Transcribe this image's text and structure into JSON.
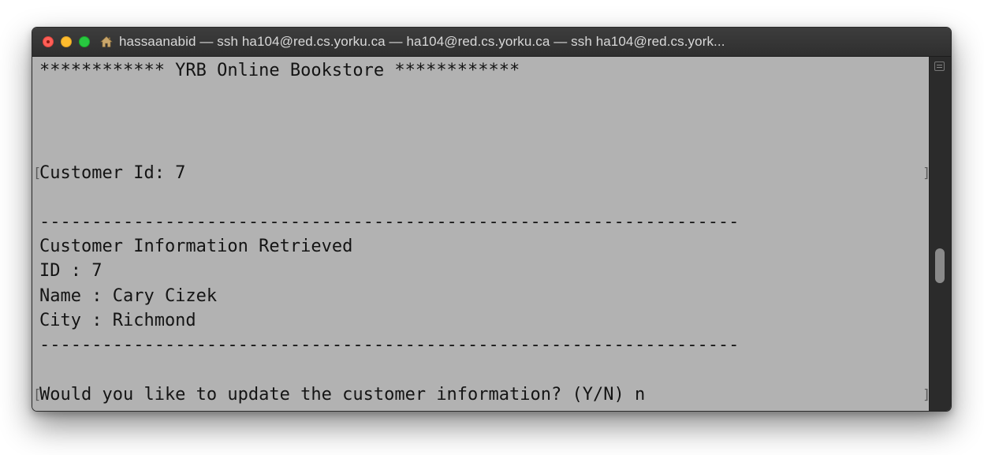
{
  "window": {
    "title": "hassaanabid — ssh ha104@red.cs.yorku.ca — ha104@red.cs.yorku.ca — ssh ha104@red.cs.york..."
  },
  "terminal": {
    "header": "************ YRB Online Bookstore ************",
    "customer_id_line": "Customer Id: 7",
    "separator_top": "-------------------------------------------------------------------",
    "info_heading": "Customer Information Retrieved",
    "id_line": "ID : 7",
    "name_line": "Name : Cary Cizek",
    "city_line": "City : Richmond",
    "separator_bottom": "-------------------------------------------------------------------",
    "update_prompt": "Would you like to update the customer information? (Y/N) n",
    "mark_open": "[",
    "mark_close": "]"
  },
  "colors": {
    "terminal_background": "#b2b2b2",
    "titlebar_background": "#333333",
    "close": "#fe5f57",
    "minimize": "#febc2e",
    "maximize": "#28c840"
  },
  "icons": [
    "close-button",
    "minimize-button",
    "maximize-button",
    "home-icon",
    "scroll-menu-icon"
  ]
}
